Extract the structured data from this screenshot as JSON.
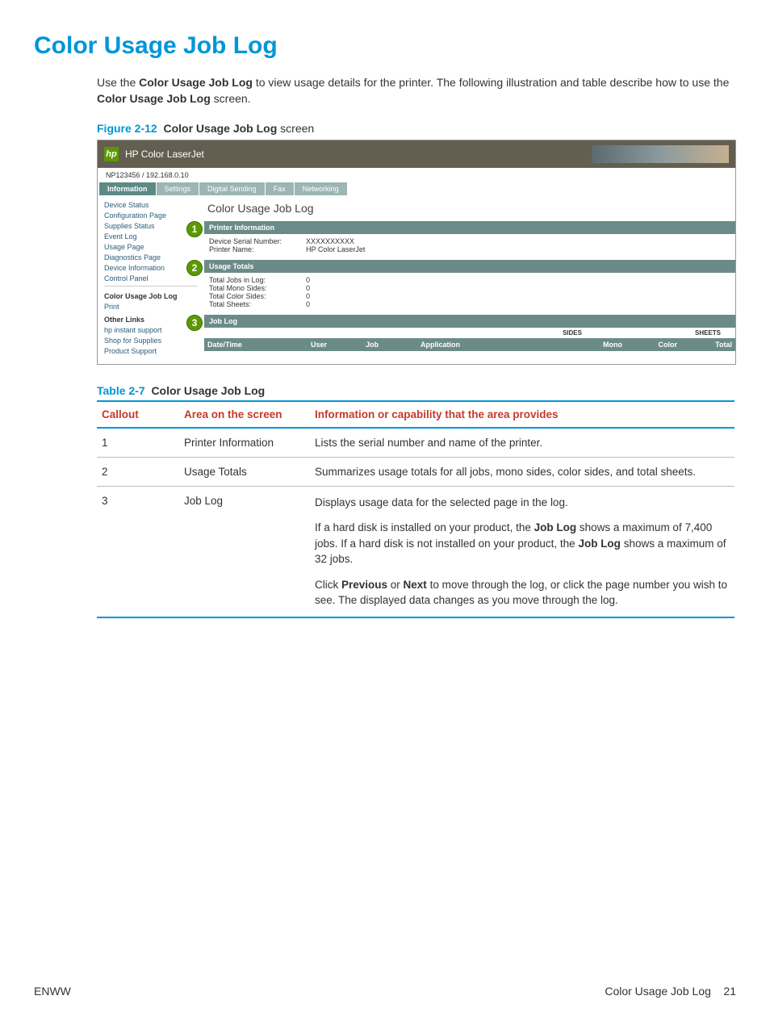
{
  "page_title": "Color Usage Job Log",
  "intro": {
    "pre": "Use the ",
    "bold1": "Color Usage Job Log",
    "mid": " to view usage details for the printer. The following illustration and table describe how to use the ",
    "bold2": "Color Usage Job Log",
    "post": " screen."
  },
  "figure": {
    "label": "Figure 2-12",
    "title_bold": "Color Usage Job Log",
    "title_rest": " screen"
  },
  "screenshot": {
    "product_name": "HP Color LaserJet",
    "ip_line": "NP123456 / 192.168.0.10",
    "tabs": {
      "t0": "Information",
      "t1": "Settings",
      "t2": "Digital Sending",
      "t3": "Fax",
      "t4": "Networking"
    },
    "sidebar": {
      "s0": "Device Status",
      "s1": "Configuration Page",
      "s2": "Supplies Status",
      "s3": "Event Log",
      "s4": "Usage Page",
      "s5": "Diagnostics Page",
      "s6": "Device Information",
      "s7": "Control Panel",
      "s8": "Color Usage Job Log",
      "s9": "Print",
      "other_links": "Other Links",
      "ol0": "hp instant support",
      "ol1": "Shop for Supplies",
      "ol2": "Product Support"
    },
    "callouts": {
      "c1": "1",
      "c2": "2",
      "c3": "3"
    },
    "content": {
      "page_title": "Color Usage Job Log",
      "printer_info": {
        "title": "Printer Information",
        "serial_label": "Device Serial Number:",
        "serial_value": "XXXXXXXXXX",
        "name_label": "Printer Name:",
        "name_value": "HP Color LaserJet"
      },
      "usage_totals": {
        "title": "Usage Totals",
        "r0l": "Total Jobs in Log:",
        "r0v": "0",
        "r1l": "Total Mono Sides:",
        "r1v": "0",
        "r2l": "Total Color Sides:",
        "r2v": "0",
        "r3l": "Total Sheets:",
        "r3v": "0"
      },
      "job_log": {
        "title": "Job Log",
        "group_sides": "SIDES",
        "group_sheets": "SHEETS",
        "h0": "Date/Time",
        "h1": "User",
        "h2": "Job",
        "h3": "Application",
        "h4": "Mono",
        "h5": "Color",
        "h6": "Total"
      }
    }
  },
  "table": {
    "label": "Table 2-7",
    "title": "Color Usage Job Log",
    "headers": {
      "h0": "Callout",
      "h1": "Area on the screen",
      "h2": "Information or capability that the area provides"
    },
    "rows": {
      "r1": {
        "callout": "1",
        "area": "Printer Information",
        "info": "Lists the serial number and name of the printer."
      },
      "r2": {
        "callout": "2",
        "area": "Usage Totals",
        "info": "Summarizes usage totals for all jobs, mono sides, color sides, and total sheets."
      },
      "r3": {
        "callout": "3",
        "area": "Job Log",
        "p1": "Displays usage data for the selected page in the log.",
        "p2a": "If a hard disk is installed on your product, the ",
        "p2b": "Job Log",
        "p2c": " shows a maximum of 7,400 jobs. If a hard disk is not installed on your product, the  ",
        "p2d": "Job Log",
        "p2e": " shows a maximum of 32 jobs.",
        "p3a": "Click ",
        "p3b": "Previous",
        "p3c": " or ",
        "p3d": "Next",
        "p3e": " to move through the log, or click the page number you wish to see. The displayed data changes as you move through the log."
      }
    }
  },
  "footer": {
    "left": "ENWW",
    "right_text": "Color Usage Job Log",
    "page_no": "21"
  }
}
